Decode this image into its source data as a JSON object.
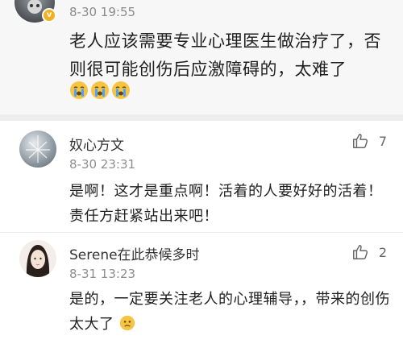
{
  "top_comment": {
    "time": "8-30 19:55",
    "text": "老人应该需要专业心理医生做治疗了，否则很可能创伤后应激障碍的，太难了",
    "emojis": [
      "crying-emoji",
      "crying-emoji",
      "crying-emoji"
    ]
  },
  "replies": [
    {
      "name": "奴心方文",
      "time": "8-30 23:31",
      "likes": "7",
      "text": "是啊！这才是重点啊！活着的人要好好的活着！责任方赶紧站出来吧！"
    },
    {
      "name": "Serene在此恭候多时",
      "time": "8-31 13:23",
      "likes": "2",
      "text": "是的，一定要关注老人的心理辅导，，带来的创伤太大了",
      "trailing_emoji": "worried-emoji"
    }
  ],
  "colors": {
    "verified": "#f2b01e",
    "top_bg": "#f7f7f7"
  }
}
